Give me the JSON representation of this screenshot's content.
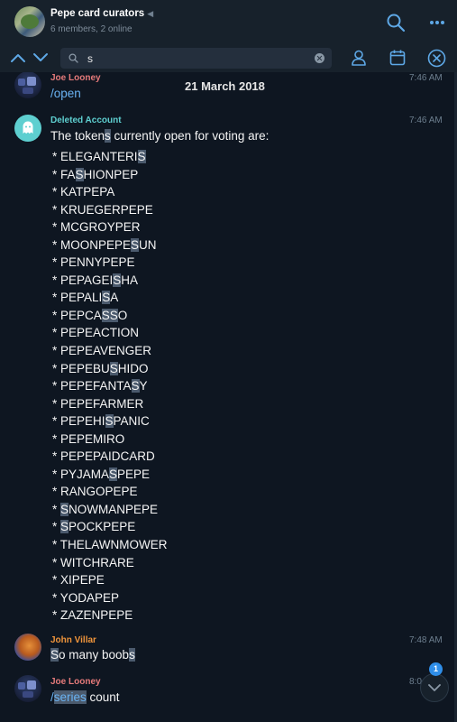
{
  "header": {
    "title": "Pepe card curators",
    "subtitle": "6 members, 2 online",
    "icons": [
      "group-avatar",
      "mute-icon",
      "search-icon",
      "more-vertical-icon"
    ]
  },
  "search": {
    "value": "s",
    "icons": [
      "chevron-up-icon",
      "chevron-down-icon",
      "search-icon",
      "clear-icon",
      "user-filter-icon",
      "calendar-icon",
      "close-icon"
    ]
  },
  "date_label": "21 March 2018",
  "messages": [
    {
      "sender": "Joe Looney",
      "sender_color": "#e57a7a",
      "time": "7:46 AM",
      "text": "/open"
    },
    {
      "sender": "Deleted Account",
      "sender_color": "#5ecfd0",
      "time": "7:46 AM",
      "text_pre": "The token",
      "text_hl": "s",
      "text_post": " currently open for voting are:",
      "items": [
        {
          "pre": "* ELEGANTERI",
          "hl": "S",
          "post": ""
        },
        {
          "pre": "* FA",
          "hl": "S",
          "post": "HIONPEP"
        },
        {
          "pre": "* KATPEPA",
          "hl": "",
          "post": ""
        },
        {
          "pre": "* KRUEGERPEPE",
          "hl": "",
          "post": ""
        },
        {
          "pre": "* MCGROYPER",
          "hl": "",
          "post": ""
        },
        {
          "pre": "* MOONPEPE",
          "hl": "S",
          "post": "UN"
        },
        {
          "pre": "* PENNYPEPE",
          "hl": "",
          "post": ""
        },
        {
          "pre": "* PEPAGEI",
          "hl": "S",
          "post": "HA"
        },
        {
          "pre": "* PEPALI",
          "hl": "S",
          "post": "A"
        },
        {
          "pre": "* PEPCA",
          "hl": "SS",
          "post": "O"
        },
        {
          "pre": "* PEPEACTION",
          "hl": "",
          "post": ""
        },
        {
          "pre": "* PEPEAVENGER",
          "hl": "",
          "post": ""
        },
        {
          "pre": "* PEPEBU",
          "hl": "S",
          "post": "HIDO"
        },
        {
          "pre": "* PEPEFANTA",
          "hl": "S",
          "post": "Y"
        },
        {
          "pre": "* PEPEFARMER",
          "hl": "",
          "post": ""
        },
        {
          "pre": "* PEPEHI",
          "hl": "S",
          "post": "PANIC"
        },
        {
          "pre": "* PEPEMIRO",
          "hl": "",
          "post": ""
        },
        {
          "pre": "* PEPEPAIDCARD",
          "hl": "",
          "post": ""
        },
        {
          "pre": "* PYJAMA",
          "hl": "S",
          "post": "PEPE"
        },
        {
          "pre": "* RANGOPEPE",
          "hl": "",
          "post": ""
        },
        {
          "pre": "* ",
          "hl": "S",
          "post": "NOWMANPEPE"
        },
        {
          "pre": "* ",
          "hl": "S",
          "post": "POCKPEPE"
        },
        {
          "pre": "* THELAWNMOWER",
          "hl": "",
          "post": ""
        },
        {
          "pre": "* WITCHRARE",
          "hl": "",
          "post": ""
        },
        {
          "pre": "* XIPEPE",
          "hl": "",
          "post": ""
        },
        {
          "pre": "* YODAPEP",
          "hl": "",
          "post": ""
        },
        {
          "pre": "* ZAZENPEPE",
          "hl": "",
          "post": ""
        }
      ]
    },
    {
      "sender": "John Villar",
      "sender_color": "#f0953b",
      "time": "7:48 AM",
      "text_hl1": "S",
      "text_mid": "o many boob",
      "text_hl2": "s"
    },
    {
      "sender": "Joe Looney",
      "sender_color": "#e57a7a",
      "time": "8:0",
      "text_pre": "/",
      "text_hl": "series",
      "text_post": " count"
    }
  ],
  "scroll": {
    "badge_count": "1"
  },
  "colors": {
    "accent": "#6ab3f3",
    "background": "#0e1621",
    "header": "#17212b",
    "highlight": "#4b5a6d",
    "badge": "#2f8ee8"
  }
}
